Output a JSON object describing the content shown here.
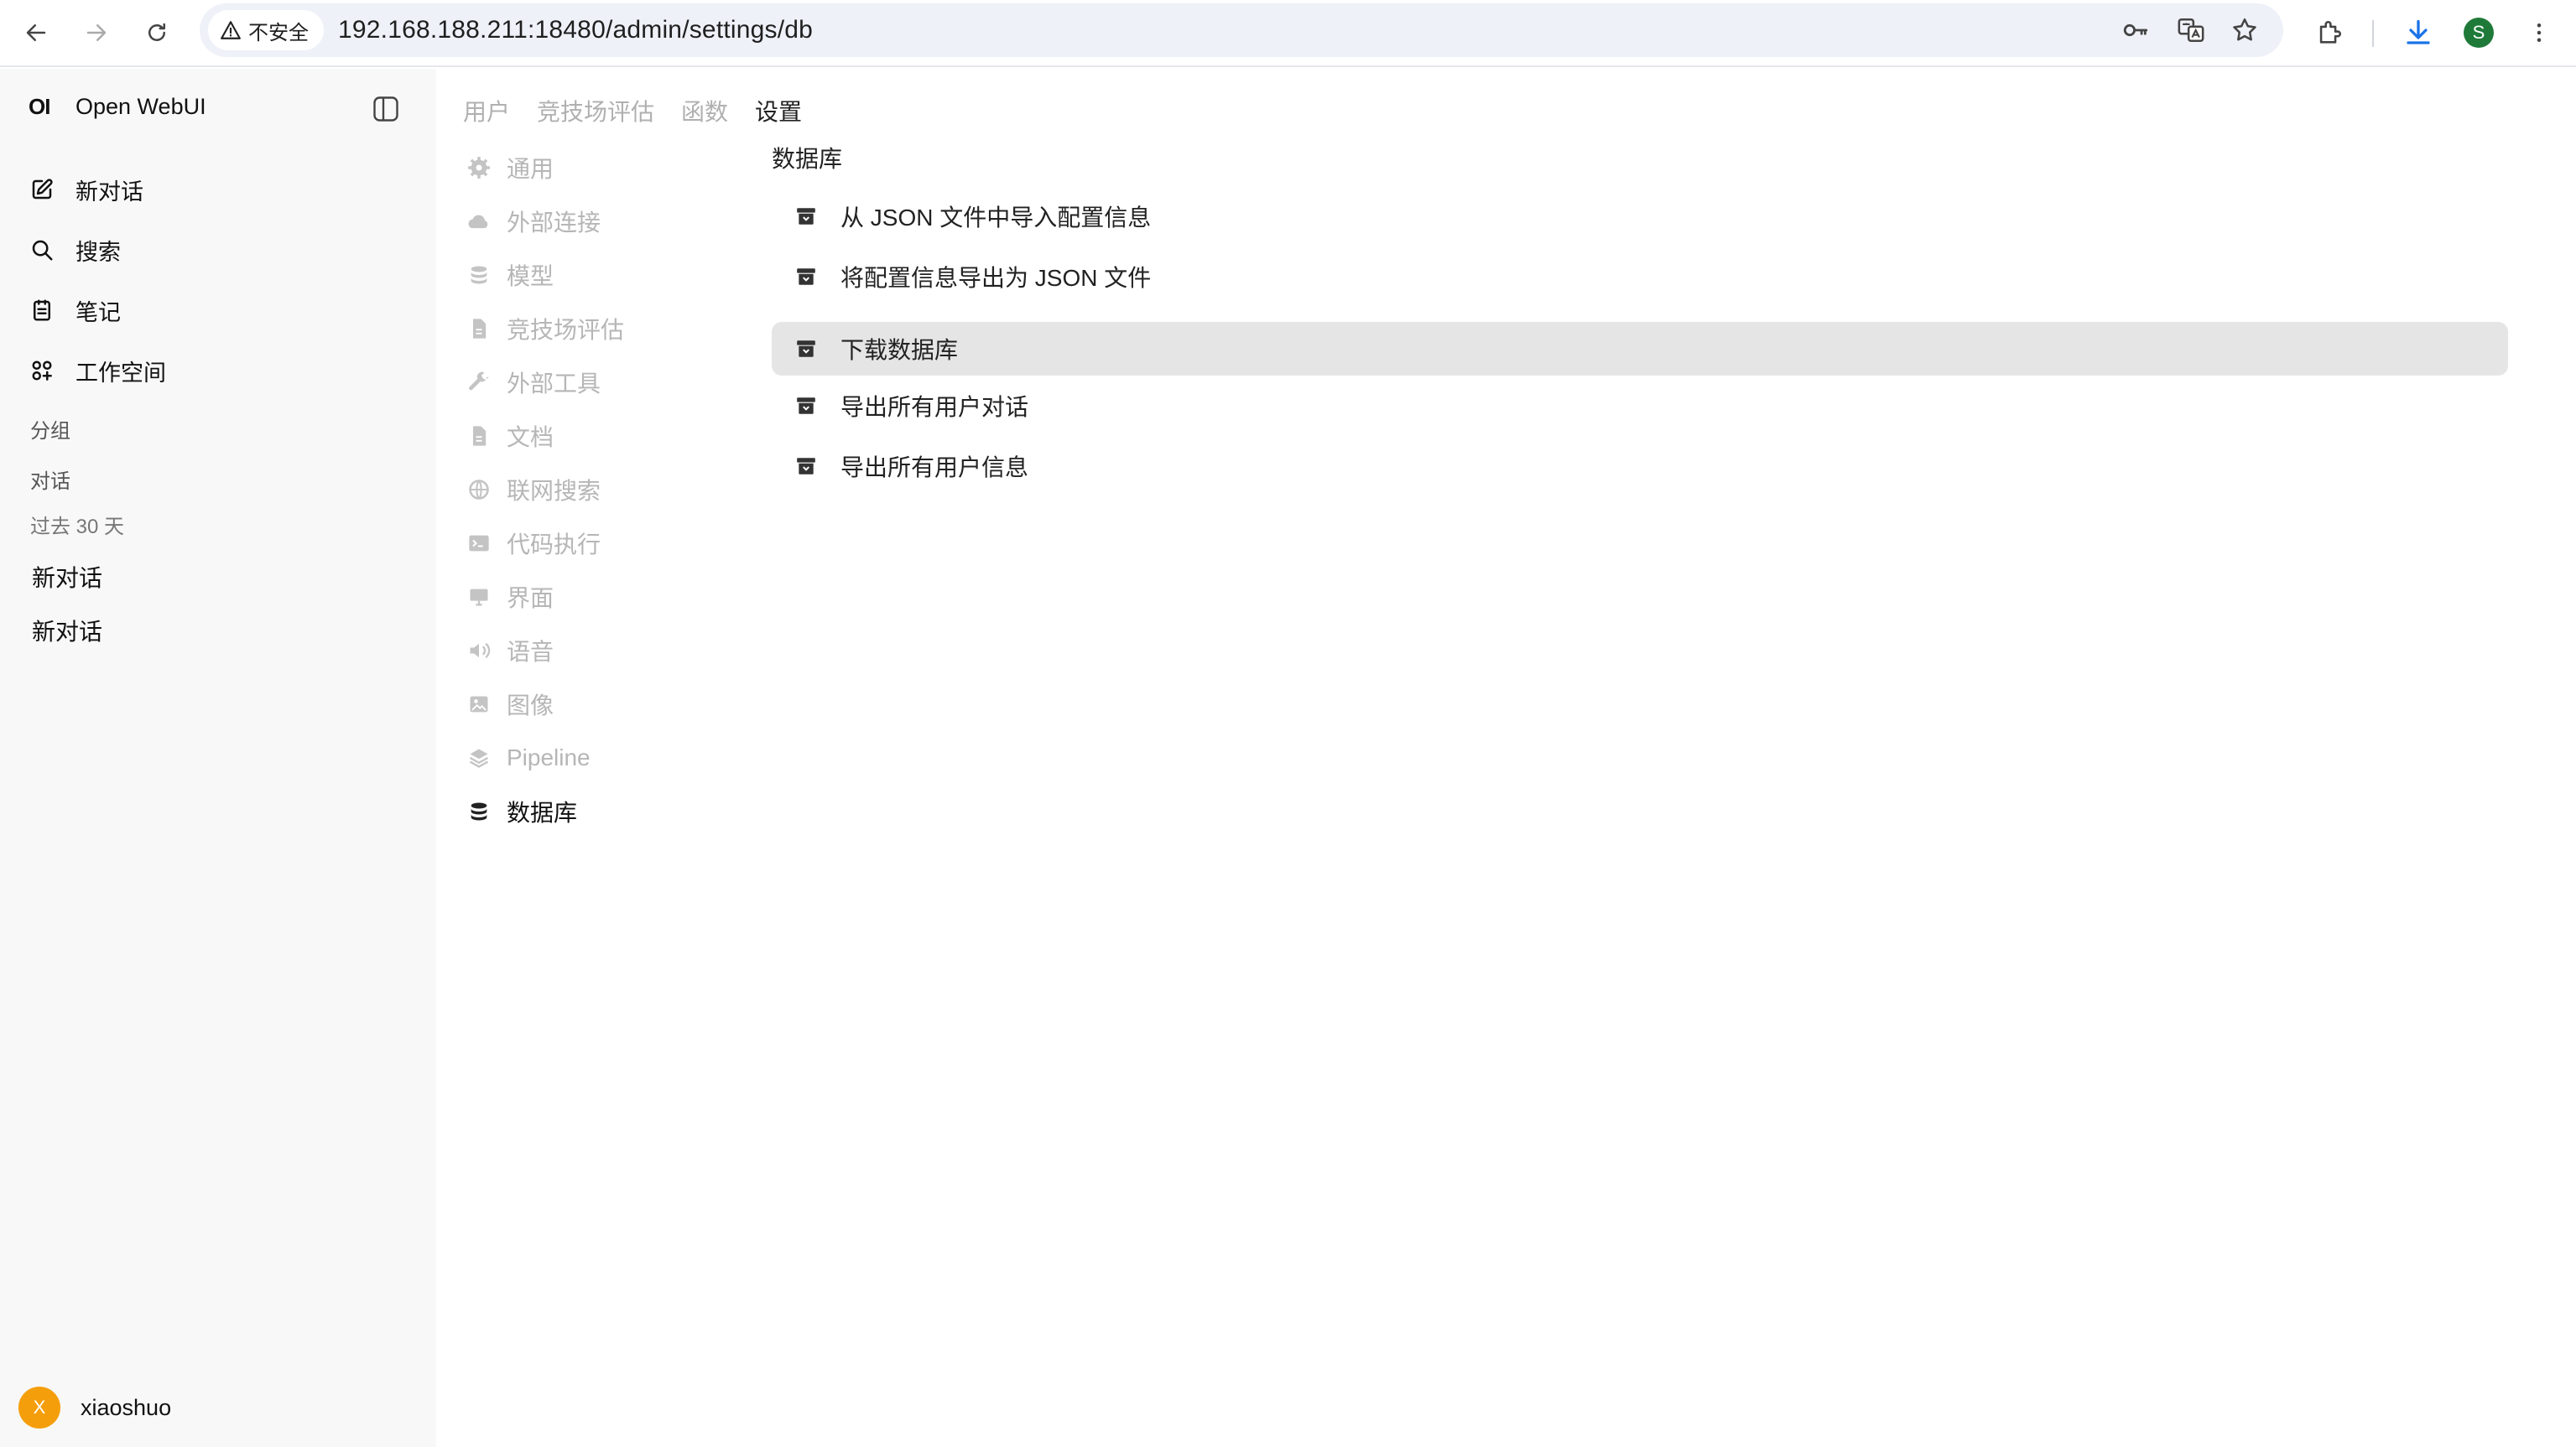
{
  "browser": {
    "security_label": "不安全",
    "url": "192.168.188.211:18480/admin/settings/db",
    "profile_initial": "S"
  },
  "app": {
    "logo": "OI",
    "name": "Open WebUI"
  },
  "sidebar": {
    "nav": [
      {
        "label": "新对话",
        "icon": "edit-icon"
      },
      {
        "label": "搜索",
        "icon": "search-icon"
      },
      {
        "label": "笔记",
        "icon": "notes-icon"
      },
      {
        "label": "工作空间",
        "icon": "workspace-icon"
      }
    ],
    "groups_label": "分组",
    "chats_label": "对话",
    "period_label": "过去 30 天",
    "chats": [
      "新对话",
      "新对话"
    ],
    "user": {
      "initial": "X",
      "name": "xiaoshuo"
    }
  },
  "admin_tabs": [
    {
      "label": "用户",
      "active": false
    },
    {
      "label": "竞技场评估",
      "active": false
    },
    {
      "label": "函数",
      "active": false
    },
    {
      "label": "设置",
      "active": true
    }
  ],
  "settings_nav": [
    {
      "label": "通用",
      "icon": "gear-icon",
      "active": false
    },
    {
      "label": "外部连接",
      "icon": "cloud-icon",
      "active": false
    },
    {
      "label": "模型",
      "icon": "stack-icon",
      "active": false
    },
    {
      "label": "竞技场评估",
      "icon": "document-icon",
      "active": false
    },
    {
      "label": "外部工具",
      "icon": "wrench-icon",
      "active": false
    },
    {
      "label": "文档",
      "icon": "document-icon",
      "active": false
    },
    {
      "label": "联网搜索",
      "icon": "globe-icon",
      "active": false
    },
    {
      "label": "代码执行",
      "icon": "terminal-icon",
      "active": false
    },
    {
      "label": "界面",
      "icon": "monitor-icon",
      "active": false
    },
    {
      "label": "语音",
      "icon": "speaker-icon",
      "active": false
    },
    {
      "label": "图像",
      "icon": "image-icon",
      "active": false
    },
    {
      "label": "Pipeline",
      "icon": "layers-icon",
      "active": false
    },
    {
      "label": "数据库",
      "icon": "database-icon",
      "active": true
    }
  ],
  "database": {
    "title": "数据库",
    "actions": [
      {
        "label": "从 JSON 文件中导入配置信息"
      },
      {
        "label": "将配置信息导出为 JSON 文件"
      },
      {
        "label": "下载数据库"
      },
      {
        "label": "导出所有用户对话"
      },
      {
        "label": "导出所有用户信息"
      }
    ]
  }
}
